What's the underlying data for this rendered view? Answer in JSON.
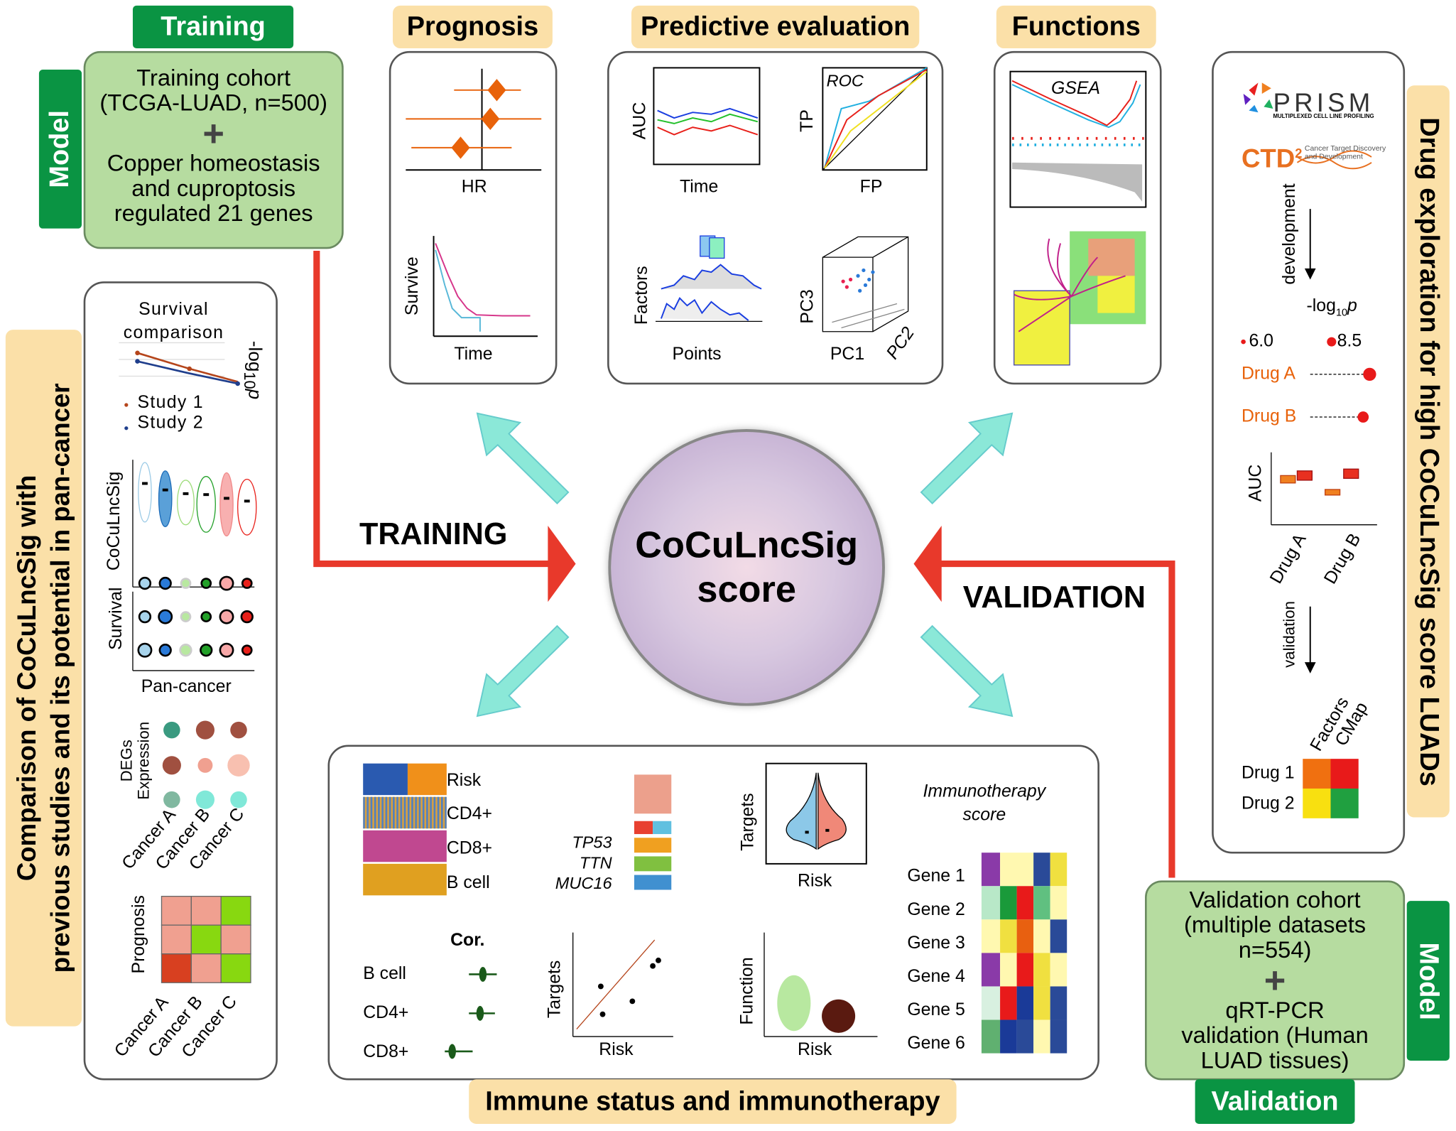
{
  "training": {
    "tab": "Training",
    "model_tab": "Model",
    "cohort": [
      "Training cohort",
      "(TCGA-LUAD, n=500)"
    ],
    "plus": "+",
    "genes": [
      "Copper homeostasis",
      "and cuproptosis",
      "regulated 21 genes"
    ]
  },
  "prognosis": {
    "tab": "Prognosis",
    "hr_label": "HR",
    "survive_label": "Survive",
    "time_label": "Time"
  },
  "predictive": {
    "tab": "Predictive evaluation",
    "auc": "AUC",
    "time": "Time",
    "roc": "ROC",
    "tp": "TP",
    "fp": "FP",
    "factors": "Factors",
    "points": "Points",
    "pc1": "PC1",
    "pc2": "PC2",
    "pc3": "PC3"
  },
  "functions": {
    "tab": "Functions",
    "gsea": "GSEA"
  },
  "center": {
    "line1": "CoCuLncSig",
    "line2": "score"
  },
  "arrows": {
    "training": "TRAINING",
    "validation": "VALIDATION"
  },
  "left": {
    "tab_line1": "Comparison of CoCuLncSig with",
    "tab_line2": "previous studies and its potential in pan-cancer",
    "survival_title": [
      "Survival",
      "comparison"
    ],
    "log_label": "-log",
    "log_sub": "10",
    "log_p": "p",
    "study1": "Study 1",
    "study2": "Study 2",
    "study_colors": [
      "#b5451b",
      "#1f3e8c"
    ],
    "coculncsig_label": "CoCuLncSig",
    "survival_label": "Survival",
    "pancancer_label": "Pan-cancer",
    "degs_label": [
      "DEGs",
      "Expression"
    ],
    "cancers": [
      "Cancer A",
      "Cancer B",
      "Cancer C"
    ],
    "prognosis_label": "Prognosis"
  },
  "immune": {
    "tab": "Immune status and immunotherapy",
    "heat_rows": [
      "Risk",
      "CD4+",
      "CD8+",
      "B cell"
    ],
    "mut_genes": [
      "TP53",
      "TTN",
      "MUC16"
    ],
    "targets": "Targets",
    "risk": "Risk",
    "cor_title": "Cor.",
    "cor_rows": [
      "B cell",
      "CD4+",
      "CD8+"
    ],
    "function": "Function",
    "immuno_title": [
      "Immunotherapy",
      "score"
    ],
    "genes": [
      "Gene 1",
      "Gene 2",
      "Gene 3",
      "Gene 4",
      "Gene 5",
      "Gene 6"
    ]
  },
  "drug": {
    "tab": "Drug exploration for high CoCuLncSig score LUADs",
    "prism": "PRISM",
    "prism_sub": "MULTIPLEXED CELL LINE PROFILING",
    "ctd": "CTD",
    "ctd_sup": "2",
    "ctd_sub": [
      "Cancer Target Discovery",
      "and Development"
    ],
    "development": "development",
    "log_label": "-log",
    "log_sub": "10",
    "log_p": "p",
    "legend_small": "6.0",
    "legend_large": "8.5",
    "drugA": "Drug A",
    "drugB": "Drug B",
    "auc": "AUC",
    "validation": "validation",
    "factors": "Factors",
    "cmap": "CMap",
    "drug1": "Drug 1",
    "drug2": "Drug 2"
  },
  "validation": {
    "tab": "Validation",
    "model_tab": "Model",
    "cohort": [
      "Validation cohort",
      "(multiple datasets",
      "n=554)"
    ],
    "plus": "+",
    "qpcr": [
      "qRT-PCR",
      "validation (Human",
      "LUAD tissues)"
    ]
  },
  "colors": {
    "green": "#0a9443",
    "light_green": "#b6dca0",
    "yellow": "#fbe0a8",
    "red": "#e8392b",
    "cyan": "#8be8d8",
    "orange": "#e8620a"
  }
}
